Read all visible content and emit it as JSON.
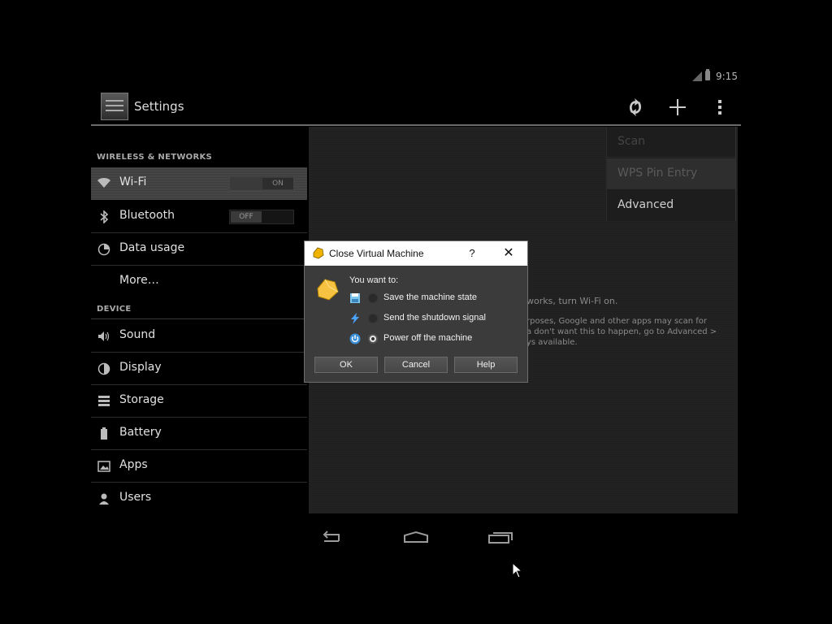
{
  "status_bar": {
    "time": "9:15",
    "icons": [
      "signal-icon",
      "battery-icon"
    ]
  },
  "action_bar": {
    "title": "Settings",
    "actions": [
      "wps-icon",
      "add-icon",
      "overflow-menu-icon"
    ]
  },
  "nav": {
    "sections": [
      {
        "title": "WIRELESS & NETWORKS"
      },
      {
        "title": "DEVICE"
      }
    ],
    "items": [
      {
        "label": "Wi-Fi",
        "icon": "wifi-icon",
        "toggle": "ON",
        "selected": true
      },
      {
        "label": "Bluetooth",
        "icon": "bluetooth-icon",
        "toggle": "OFF"
      },
      {
        "label": "Data usage",
        "icon": "data-usage-icon"
      },
      {
        "label": "More…"
      },
      {
        "label": "Sound",
        "icon": "sound-icon"
      },
      {
        "label": "Display",
        "icon": "display-icon"
      },
      {
        "label": "Storage",
        "icon": "storage-icon"
      },
      {
        "label": "Battery",
        "icon": "battery-icon"
      },
      {
        "label": "Apps",
        "icon": "apps-icon"
      },
      {
        "label": "Users",
        "icon": "users-icon"
      }
    ]
  },
  "panel": {
    "lines": [
      "works, turn Wi-Fi on.",
      "rposes, Google and other apps may scan for",
      "a don't want this to happen, go to Advanced >",
      "ys available."
    ]
  },
  "overflow_menu": {
    "items": [
      "Scan",
      "WPS Pin Entry",
      "Advanced"
    ]
  },
  "bottom_nav": [
    "back-icon",
    "home-icon",
    "recents-icon"
  ],
  "dialog": {
    "title": "Close Virtual Machine",
    "help_glyph": "?",
    "close_glyph": "✕",
    "prompt": "You want to:",
    "options": [
      {
        "label": "Save the machine state",
        "icon": "save-state-icon",
        "selected": false
      },
      {
        "label": "Send the shutdown signal",
        "icon": "shutdown-signal-icon",
        "selected": false
      },
      {
        "label": "Power off the machine",
        "icon": "power-off-icon",
        "selected": true
      }
    ],
    "buttons": {
      "ok": "OK",
      "cancel": "Cancel",
      "help": "Help"
    }
  }
}
